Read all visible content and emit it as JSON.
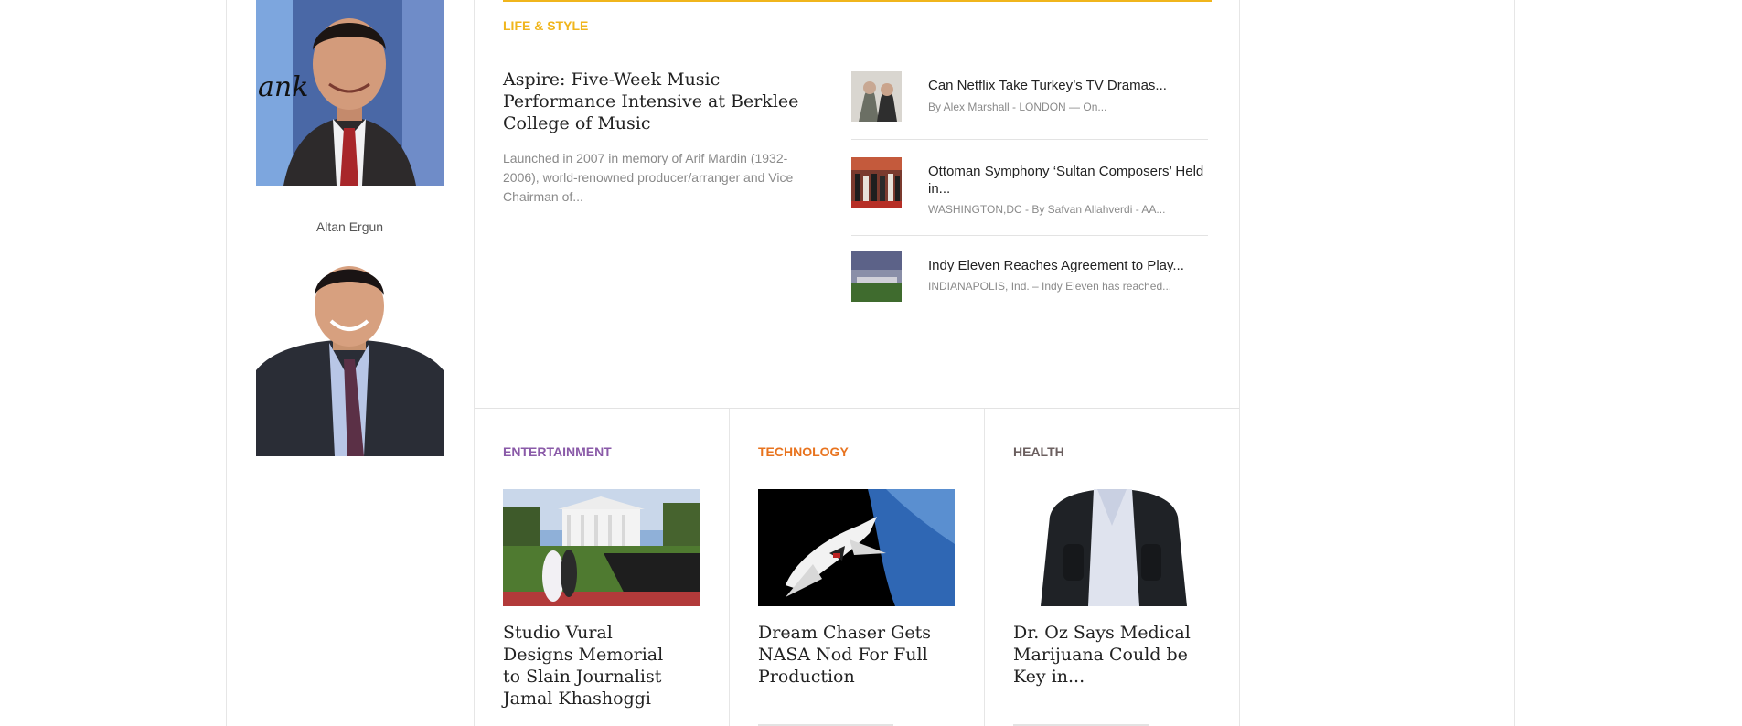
{
  "sidebar": {
    "people": [
      {
        "name": "Altan Ergun"
      }
    ]
  },
  "life_style": {
    "label": "LIFE & STYLE",
    "color": "#f0b51c",
    "feature": {
      "title": "Aspire: Five-Week Music Performance Intensive at Berklee College of Music",
      "excerpt": "Launched in 2007 in memory of Arif Mardin (1932-2006), world-renowned producer/arranger and Vice Chairman of..."
    },
    "items": [
      {
        "title": "Can Netflix Take Turkey’s TV Dramas...",
        "meta": "By Alex Marshall - LONDON — On..."
      },
      {
        "title": "Ottoman Symphony ‘Sultan Composers’ Held in...",
        "meta": "WASHINGTON,DC - By Safvan Allahverdi - AA..."
      },
      {
        "title": "Indy Eleven Reaches Agreement to Play...",
        "meta": "INDIANAPOLIS, Ind. – Indy Eleven has reached..."
      }
    ]
  },
  "columns": [
    {
      "label": "ENTERTAINMENT",
      "color": "#8a5aa8",
      "title": "Studio Vural Designs Memorial to Slain Journalist Jamal Khashoggi"
    },
    {
      "label": "TECHNOLOGY",
      "color": "#e8731e",
      "title": "Dream Chaser Gets NASA Nod For Full Production"
    },
    {
      "label": "HEALTH",
      "color": "#6b5f5f",
      "title": "Dr. Oz Says Medical Marijuana Could be Key in..."
    }
  ]
}
